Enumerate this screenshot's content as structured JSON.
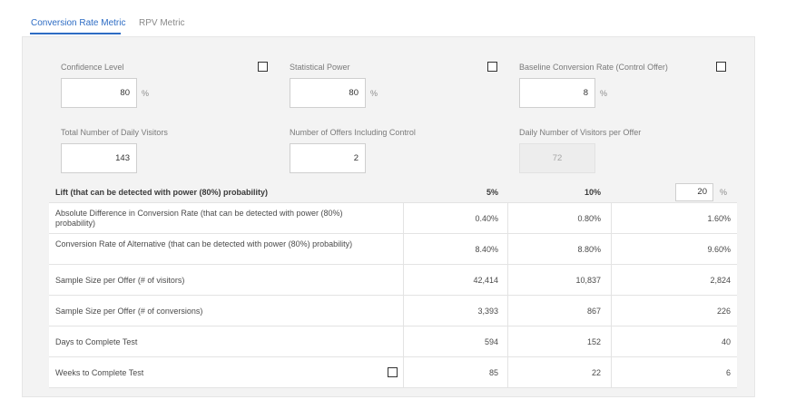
{
  "tabs": [
    {
      "label": "Conversion Rate Metric",
      "active": true
    },
    {
      "label": "RPV Metric",
      "active": false
    }
  ],
  "inputs": {
    "confidence_level": {
      "label": "Confidence Level",
      "value": "80",
      "unit": "%"
    },
    "statistical_power": {
      "label": "Statistical Power",
      "value": "80",
      "unit": "%"
    },
    "baseline_conversion_rate": {
      "label": "Baseline Conversion Rate (Control Offer)",
      "value": "8",
      "unit": "%"
    },
    "total_daily_visitors": {
      "label": "Total Number of Daily Visitors",
      "value": "143"
    },
    "number_of_offers": {
      "label": "Number of Offers Including Control",
      "value": "2"
    },
    "daily_visitors_per_offer": {
      "label": "Daily Number of Visitors per Offer",
      "value": "72"
    }
  },
  "results": {
    "header": {
      "label": "Lift (that can be detected with power (80%) probability)",
      "values": [
        "5%",
        "10%"
      ],
      "custom_value": "20",
      "custom_unit": "%"
    },
    "rows": [
      {
        "label": "Absolute Difference in Conversion Rate (that can be detected with power (80%) probability)",
        "values": [
          "0.40%",
          "0.80%",
          "1.60%"
        ]
      },
      {
        "label": "Conversion Rate of Alternative (that can be detected with power (80%) probability)",
        "values": [
          "8.40%",
          "8.80%",
          "9.60%"
        ]
      },
      {
        "label": "Sample Size per Offer (# of visitors)",
        "values": [
          "42,414",
          "10,837",
          "2,824"
        ]
      },
      {
        "label": "Sample Size per Offer (# of conversions)",
        "values": [
          "3,393",
          "867",
          "226"
        ]
      },
      {
        "label": "Days to Complete Test",
        "values": [
          "594",
          "152",
          "40"
        ]
      },
      {
        "label": "Weeks to Complete Test",
        "values": [
          "85",
          "22",
          "6"
        ]
      }
    ]
  },
  "colors": {
    "accent": "#2d6cc4",
    "panel": "#f3f3f3"
  }
}
